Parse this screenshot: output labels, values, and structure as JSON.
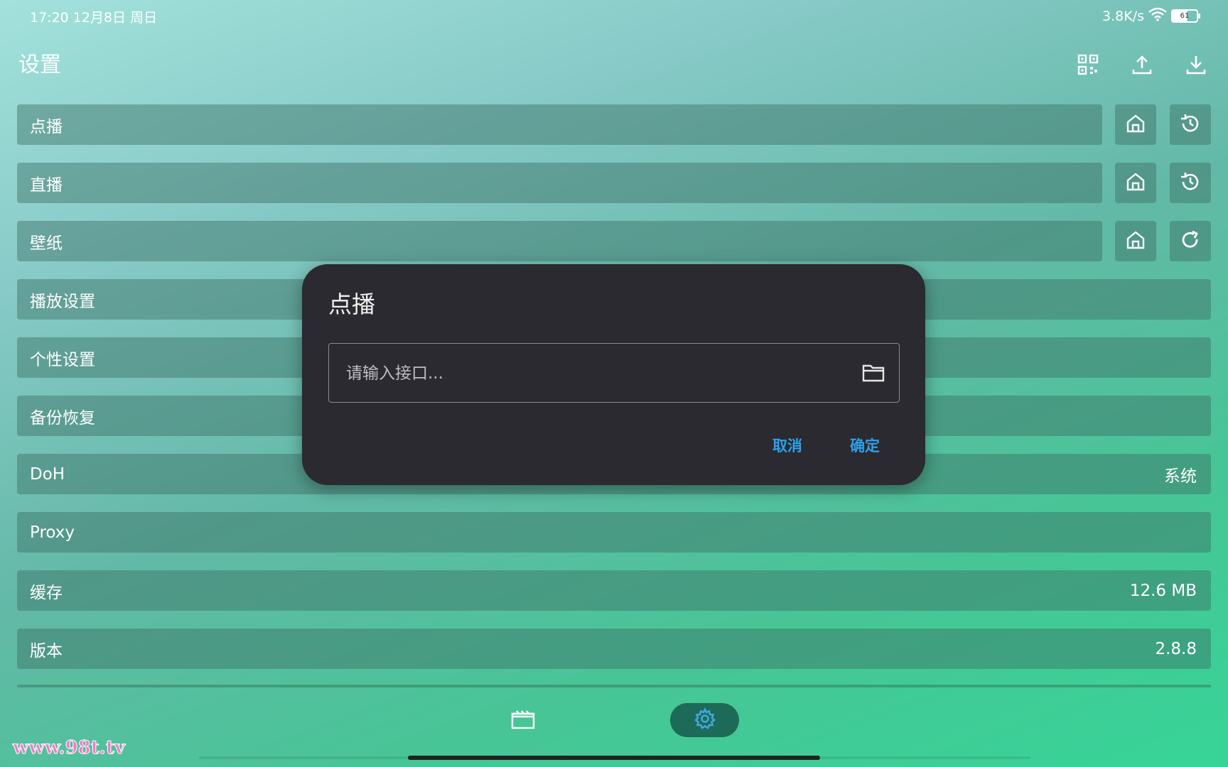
{
  "status": {
    "time": "17:20 12月8日 周日",
    "speed": "3.8K/s",
    "battery": "61"
  },
  "header": {
    "title": "设置"
  },
  "top_icons": [
    "qr-code-icon",
    "upload-icon",
    "download-icon"
  ],
  "rows": {
    "vod": {
      "label": "点播"
    },
    "live": {
      "label": "直播"
    },
    "wallpaper": {
      "label": "壁纸"
    },
    "playback": {
      "label": "播放设置"
    },
    "personal": {
      "label": "个性设置"
    },
    "backup": {
      "label": "备份恢复"
    },
    "doh": {
      "label": "DoH",
      "value": "系统"
    },
    "proxy": {
      "label": "Proxy"
    },
    "cache": {
      "label": "缓存",
      "value": "12.6 MB"
    },
    "version": {
      "label": "版本",
      "value": "2.8.8"
    }
  },
  "dialog": {
    "title": "点播",
    "input_placeholder": "请输入接口...",
    "cancel_label": "取消",
    "confirm_label": "确定"
  },
  "watermark": "www.98t.tv",
  "colors": {
    "accent": "#2fa0e8",
    "dialog_bg": "#2a2a30",
    "nav_active_bg": "#1e6a58",
    "nav_active_icon": "#3fa8e0"
  }
}
